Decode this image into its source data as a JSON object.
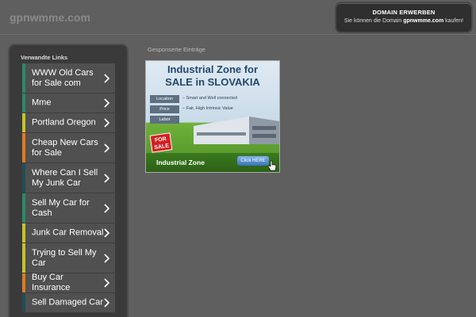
{
  "header": {
    "site_title": "gpnwmme.com",
    "domain_box": {
      "title": "DOMAIN ERWERBEN",
      "text_before": "Sie können die Domain ",
      "domain": "gpnwmme.com",
      "text_after": " kaufen!"
    }
  },
  "sidebar": {
    "title": "Verwandte Links",
    "items": [
      {
        "label": "WWW Old Cars for Sale com",
        "color": "#2a8a6a"
      },
      {
        "label": "Mme",
        "color": "#2a8a6a"
      },
      {
        "label": "Portland Oregon",
        "color": "#c8c22a"
      },
      {
        "label": "Cheap New Cars for Sale",
        "color": "#e07a1e"
      },
      {
        "label": "Where Can I Sell My Junk Car",
        "color": "#1e4e58"
      },
      {
        "label": "Sell My Car for Cash",
        "color": "#2a8a6a"
      },
      {
        "label": "Junk Car Removal",
        "color": "#c8c22a"
      },
      {
        "label": "Trying to Sell My Car",
        "color": "#c8c22a"
      },
      {
        "label": "Buy Car Insurance",
        "color": "#e07a1e"
      },
      {
        "label": "Sell Damaged Car",
        "color": "#1e4e58"
      }
    ]
  },
  "sponsored": {
    "title": "Gesponserte Einträge",
    "ad": {
      "headline_line1": "Industrial Zone for",
      "headline_line2": "SALE in SLOVAKIA",
      "rows": [
        {
          "tag": "Location",
          "desc": "– Smart and Well connected"
        },
        {
          "tag": "Price",
          "desc": "– Fair, High Intrinsic Value"
        },
        {
          "tag": "Labor",
          "desc": ""
        }
      ],
      "badge_line1": "FOR",
      "badge_line2": "SALE",
      "footer_text": "Industrial Zone",
      "button_label": "Click HERE"
    }
  }
}
